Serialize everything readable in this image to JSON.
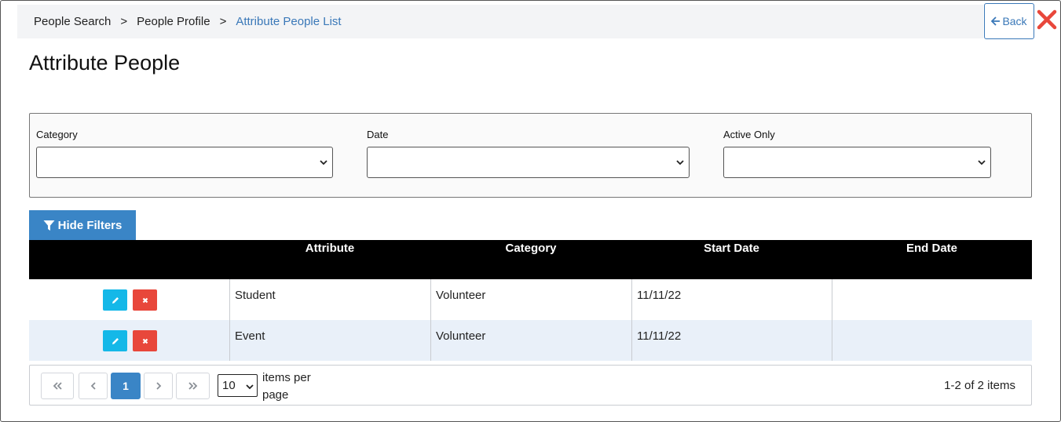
{
  "breadcrumb": {
    "items": [
      "People Search",
      "People Profile",
      "Attribute People List"
    ],
    "separator": ">"
  },
  "back_button": {
    "label": "Back",
    "icon": "arrow-left-icon"
  },
  "close_icon": "close-x-icon",
  "page_title": "Attribute People",
  "filters": {
    "category": {
      "label": "Category",
      "value": ""
    },
    "date": {
      "label": "Date",
      "value": ""
    },
    "active_only": {
      "label": "Active Only",
      "value": ""
    }
  },
  "hide_filters": {
    "label": "Hide Filters",
    "icon": "funnel-icon"
  },
  "table": {
    "columns": [
      "",
      "Attribute",
      "Category",
      "Start Date",
      "End Date"
    ],
    "rows": [
      {
        "attribute": "Student",
        "category": "Volunteer",
        "start_date": "11/11/22",
        "end_date": ""
      },
      {
        "attribute": "Event",
        "category": "Volunteer",
        "start_date": "11/11/22",
        "end_date": ""
      }
    ]
  },
  "pager": {
    "current_page": "1",
    "page_size": "10",
    "items_per_page_label": "items per page",
    "info": "1-2 of 2 items"
  },
  "colors": {
    "accent": "#3a85c6",
    "link": "#3a78b8",
    "edit": "#14b8e8",
    "delete": "#e8473b",
    "close": "#e8473b",
    "header_bg": "#000000",
    "alt_row": "#e9f0f9"
  }
}
